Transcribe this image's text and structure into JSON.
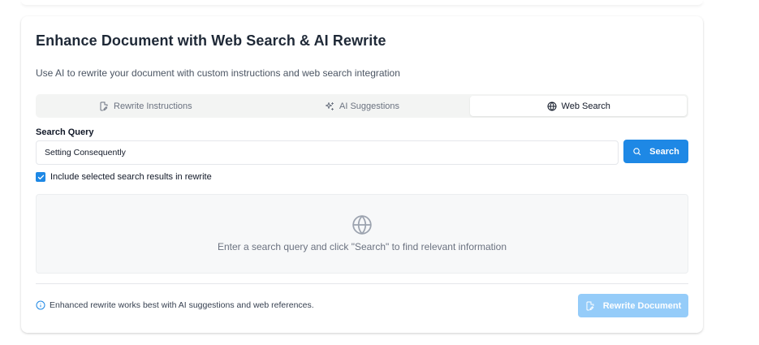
{
  "card": {
    "title": "Enhance Document with Web Search & AI Rewrite",
    "subtitle": "Use AI to rewrite your document with custom instructions and web search integration"
  },
  "tabs": [
    {
      "label": "Rewrite Instructions",
      "icon": "rewrite-doc-icon",
      "active": false
    },
    {
      "label": "AI Suggestions",
      "icon": "sparkles-icon",
      "active": false
    },
    {
      "label": "Web Search",
      "icon": "globe-icon",
      "active": true
    }
  ],
  "search": {
    "label": "Search Query",
    "value": "Setting Consequently",
    "placeholder": "",
    "button_label": "Search",
    "button_icon": "search-icon"
  },
  "include_results": {
    "checked": true,
    "label": "Include selected search results in rewrite"
  },
  "results": {
    "empty_icon": "globe-icon",
    "empty_message": "Enter a search query and click \"Search\" to find relevant information"
  },
  "footer": {
    "info_icon": "info-icon",
    "info_text": "Enhanced rewrite works best with AI suggestions and web references.",
    "rewrite_button_label": "Rewrite Document",
    "rewrite_button_disabled": true
  },
  "colors": {
    "primary": "#1e88e5",
    "primary_disabled": "#90caf9",
    "tab_bar_bg": "#f3f4f3",
    "panel_bg": "#f7f8f9"
  }
}
